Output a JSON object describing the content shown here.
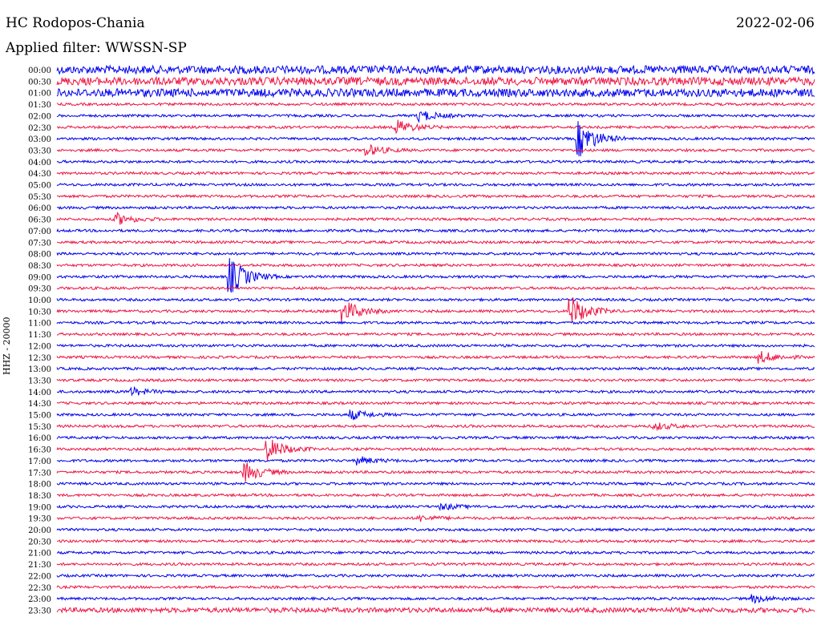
{
  "header": {
    "station": "HC Rodopos-Chania",
    "filter": "Applied filter: WWSSN-SP",
    "date": "2022-02-06"
  },
  "side_label": "HHZ - 20000",
  "colors": {
    "trace_a": "#0000ee",
    "trace_b": "#ee1444"
  },
  "chart_data": {
    "type": "line",
    "title": "HC Rodopos-Chania",
    "subtitle": "Applied filter: WWSSN-SP",
    "ylabel": "HHZ - 20000",
    "row_labels": [
      "00:00",
      "00:30",
      "01:00",
      "01:30",
      "02:00",
      "02:30",
      "03:00",
      "03:30",
      "04:00",
      "04:30",
      "05:00",
      "05:30",
      "06:00",
      "06:30",
      "07:00",
      "07:30",
      "08:00",
      "08:30",
      "09:00",
      "09:30",
      "10:00",
      "10:30",
      "11:00",
      "11:30",
      "12:00",
      "12:30",
      "13:00",
      "13:30",
      "14:00",
      "14:30",
      "15:00",
      "15:30",
      "16:00",
      "16:30",
      "17:00",
      "17:30",
      "18:00",
      "18:30",
      "19:00",
      "19:30",
      "20:00",
      "20:30",
      "21:00",
      "21:30",
      "22:00",
      "22:30",
      "23:00",
      "23:30"
    ],
    "row_colors": [
      "trace_a",
      "trace_b"
    ],
    "x_range_minutes": [
      0,
      30
    ],
    "events": [
      {
        "row": "02:00",
        "x": 0.48,
        "amplitude": 0.3
      },
      {
        "row": "02:30",
        "x": 0.45,
        "amplitude": 0.4
      },
      {
        "row": "03:00",
        "x": 0.69,
        "amplitude": 1.0
      },
      {
        "row": "03:30",
        "x": 0.41,
        "amplitude": 0.3
      },
      {
        "row": "06:30",
        "x": 0.08,
        "amplitude": 0.3
      },
      {
        "row": "09:00",
        "x": 0.23,
        "amplitude": 1.0
      },
      {
        "row": "10:30",
        "x": 0.38,
        "amplitude": 0.6
      },
      {
        "row": "10:30",
        "x": 0.68,
        "amplitude": 0.8
      },
      {
        "row": "12:30",
        "x": 0.93,
        "amplitude": 0.3
      },
      {
        "row": "14:00",
        "x": 0.1,
        "amplitude": 0.2
      },
      {
        "row": "15:00",
        "x": 0.39,
        "amplitude": 0.25
      },
      {
        "row": "15:30",
        "x": 0.79,
        "amplitude": 0.2
      },
      {
        "row": "16:30",
        "x": 0.28,
        "amplitude": 0.6
      },
      {
        "row": "17:00",
        "x": 0.4,
        "amplitude": 0.2
      },
      {
        "row": "17:30",
        "x": 0.25,
        "amplitude": 0.5
      },
      {
        "row": "19:00",
        "x": 0.51,
        "amplitude": 0.15
      },
      {
        "row": "19:30",
        "x": 0.48,
        "amplitude": 0.15
      },
      {
        "row": "23:00",
        "x": 0.92,
        "amplitude": 0.2
      }
    ]
  }
}
